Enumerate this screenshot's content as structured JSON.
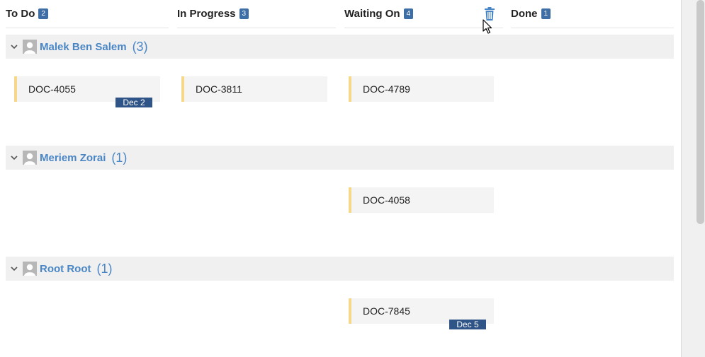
{
  "columns": [
    {
      "title": "To Do",
      "count": "2"
    },
    {
      "title": "In Progress",
      "count": "3"
    },
    {
      "title": "Waiting On",
      "count": "4"
    },
    {
      "title": "Done",
      "count": "1"
    }
  ],
  "lanes": [
    {
      "name": "Malek Ben Salem",
      "count": "(3)"
    },
    {
      "name": "Meriem Zorai",
      "count": "(1)"
    },
    {
      "name": "Root Root",
      "count": "(1)"
    }
  ],
  "cards": {
    "doc4055": {
      "id": "DOC-4055",
      "due": "Dec 2"
    },
    "doc3811": {
      "id": "DOC-3811"
    },
    "doc4789": {
      "id": "DOC-4789"
    },
    "doc4058": {
      "id": "DOC-4058"
    },
    "doc7845": {
      "id": "DOC-7845",
      "due": "Dec 5"
    }
  },
  "colors": {
    "accent": "#3d6fa6",
    "lane_name": "#4a86c5",
    "card_stripe": "#f5d889",
    "due_badge": "#2f5487"
  },
  "icons": {
    "trash": "trash-icon",
    "chevron": "chevron-down-icon",
    "avatar": "user-avatar-icon",
    "cursor": "mouse-pointer-icon"
  }
}
